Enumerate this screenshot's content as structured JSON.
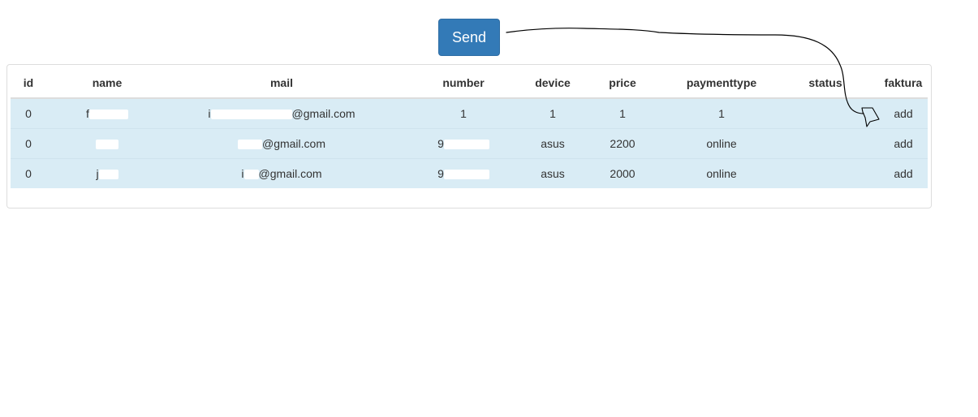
{
  "toolbar": {
    "send_label": "Send"
  },
  "table": {
    "columns": [
      "id",
      "name",
      "mail",
      "number",
      "device",
      "price",
      "paymenttype",
      "status",
      "faktura"
    ],
    "rows": [
      {
        "id": "0",
        "name": "f",
        "mail": "i",
        "mail_suffix": "@gmail.com",
        "number": "1",
        "device": "1",
        "price": "1",
        "paymenttype": "1",
        "status": "",
        "faktura": "add"
      },
      {
        "id": "0",
        "name": "",
        "mail": "",
        "mail_suffix": "@gmail.com",
        "number": "9",
        "device": "asus",
        "price": "2200",
        "paymenttype": "online",
        "status": "",
        "faktura": "add"
      },
      {
        "id": "0",
        "name": "j",
        "mail": "i",
        "mail_suffix": "@gmail.com",
        "number": "9",
        "device": "asus",
        "price": "2000",
        "paymenttype": "online",
        "status": "",
        "faktura": "add"
      }
    ]
  },
  "colors": {
    "button": "#337ab7",
    "row_highlight": "#d9ecf5",
    "annotation_stroke": "#000000"
  }
}
